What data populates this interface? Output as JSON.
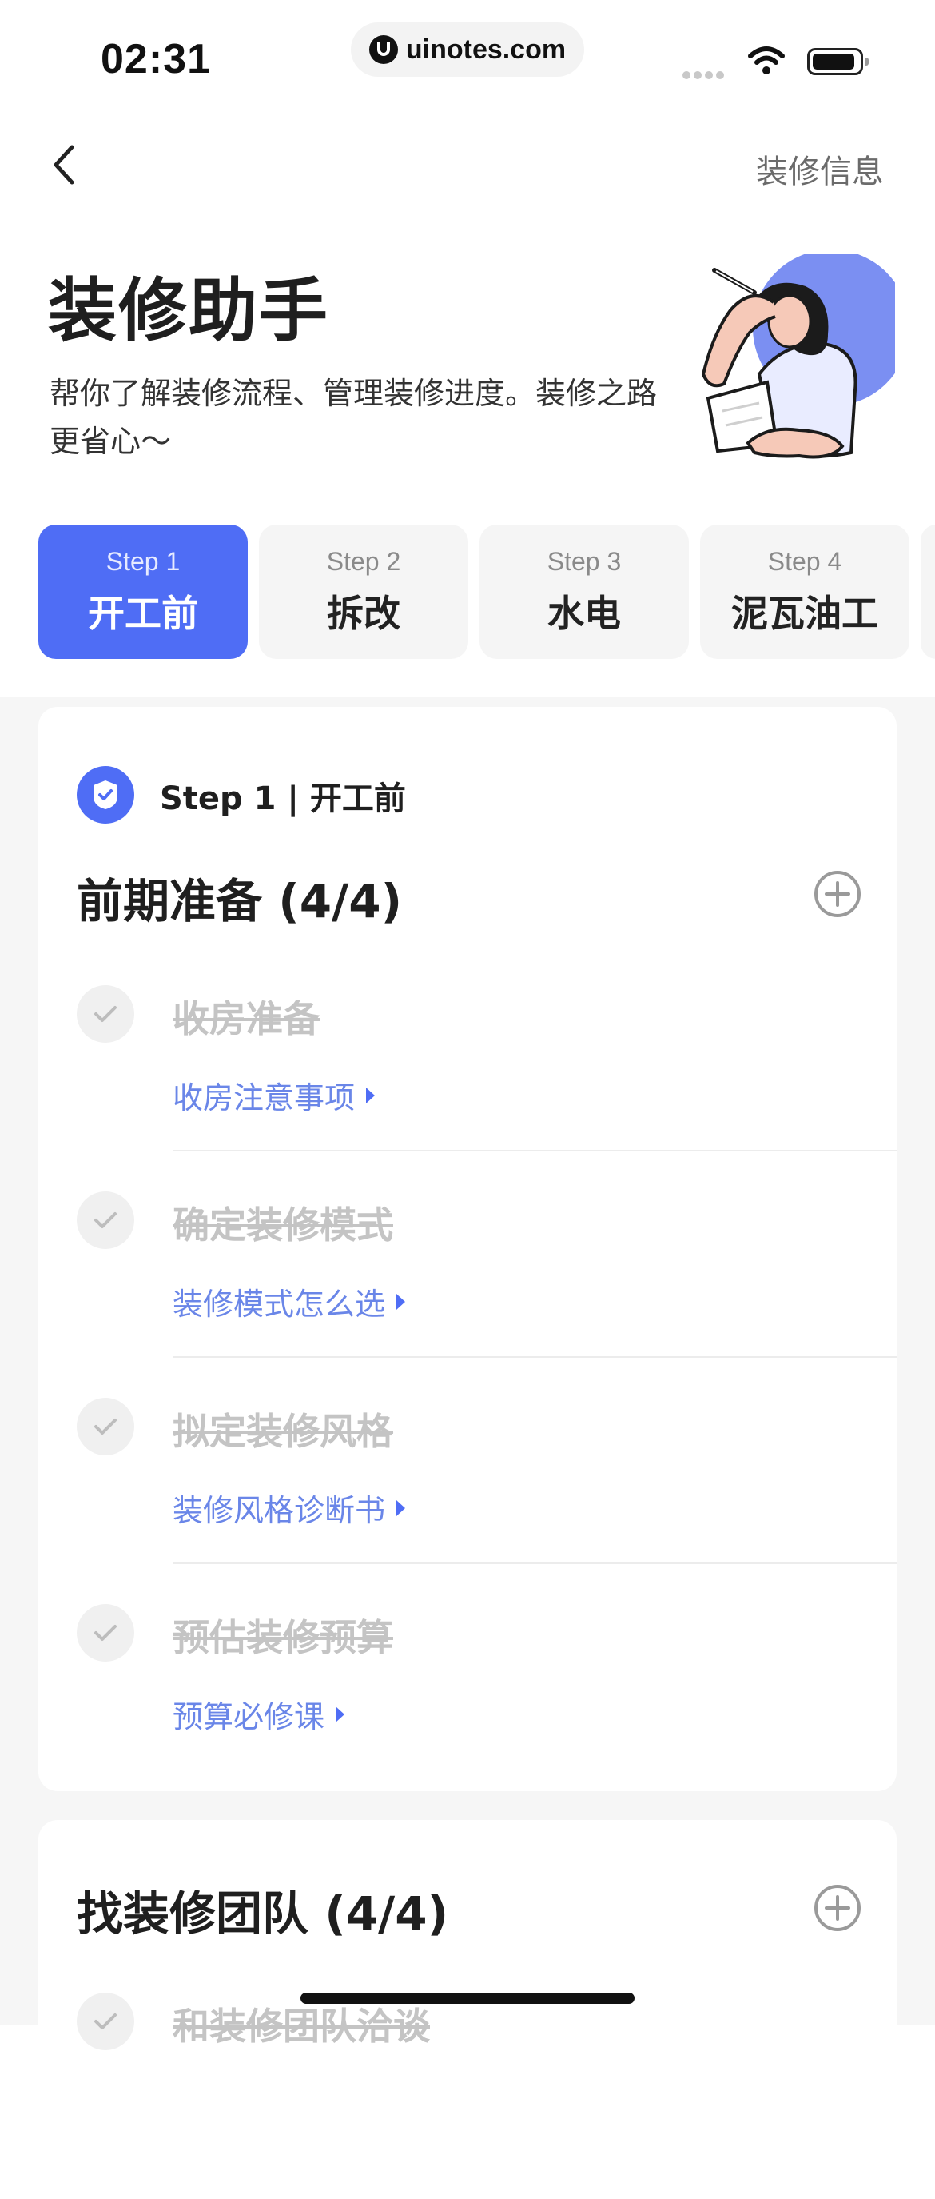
{
  "status_bar": {
    "time": "02:31",
    "url": "uinotes.com"
  },
  "nav": {
    "back_icon": "chevron-left-icon",
    "right_label": "装修信息"
  },
  "hero": {
    "title": "装修助手",
    "subtitle": "帮你了解装修流程、管理装修进度。装修之路更省心～"
  },
  "steps": [
    {
      "num": "Step 1",
      "name": "开工前",
      "active": true
    },
    {
      "num": "Step 2",
      "name": "拆改",
      "active": false
    },
    {
      "num": "Step 3",
      "name": "水电",
      "active": false
    },
    {
      "num": "Step 4",
      "name": "泥瓦油工",
      "active": false
    }
  ],
  "card1": {
    "step_heading": "Step 1 | 开工前",
    "section_title": "前期准备 (4/4)",
    "tasks": [
      {
        "title": "收房准备",
        "link": "收房注意事项"
      },
      {
        "title": "确定装修模式",
        "link": "装修模式怎么选"
      },
      {
        "title": "拟定装修风格",
        "link": "装修风格诊断书"
      },
      {
        "title": "预估装修预算",
        "link": "预算必修课"
      }
    ]
  },
  "card2": {
    "section_title": "找装修团队 (4/4)",
    "tasks": [
      {
        "title": "和装修团队洽谈"
      }
    ]
  },
  "colors": {
    "accent": "#4f6df5",
    "link": "#6a86e8",
    "done_text": "#c4c4c4",
    "illustration_circle": "#7b8ff2"
  }
}
